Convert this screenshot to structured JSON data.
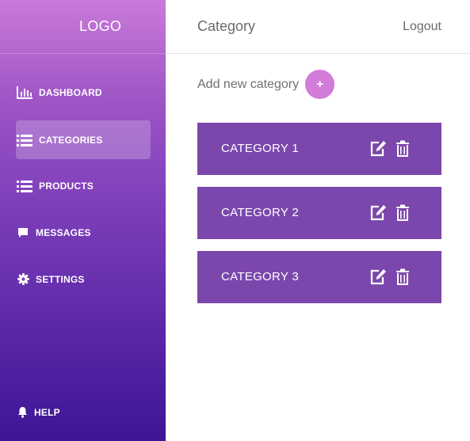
{
  "sidebar": {
    "logo": "LOGO",
    "items": [
      {
        "label": "DASHBOARD",
        "icon": "bar-chart-icon",
        "active": false
      },
      {
        "label": "CATEGORIES",
        "icon": "list-icon",
        "active": true
      },
      {
        "label": "PRODUCTS",
        "icon": "list-icon",
        "active": false
      },
      {
        "label": "MESSAGES",
        "icon": "message-icon",
        "active": false
      },
      {
        "label": "SETTINGS",
        "icon": "gear-icon",
        "active": false
      }
    ],
    "help": {
      "label": "HELP",
      "icon": "bell-icon"
    }
  },
  "header": {
    "title": "Category",
    "logout": "Logout"
  },
  "main": {
    "add_label": "Add new category",
    "add_button": "+",
    "categories": [
      {
        "name": "CATEGORY 1"
      },
      {
        "name": "CATEGORY 2"
      },
      {
        "name": "CATEGORY 3"
      }
    ]
  },
  "colors": {
    "sidebar_top": "#c979d9",
    "sidebar_bottom": "#3d1596",
    "category_row": "#7b47ad",
    "add_button": "#d37bd8"
  }
}
